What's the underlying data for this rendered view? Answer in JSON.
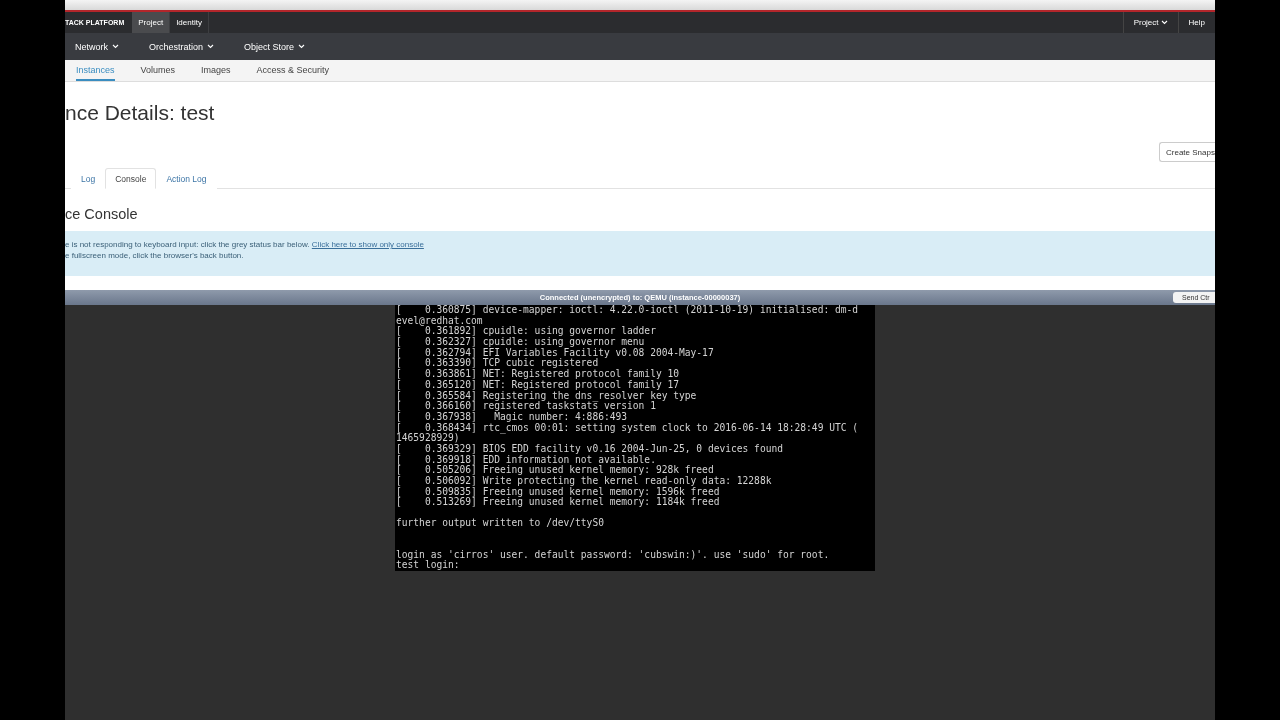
{
  "top_nav": {
    "brand": "TACK PLATFORM",
    "tabs": [
      {
        "label": "Project",
        "selected": true
      },
      {
        "label": "Identity",
        "selected": false
      }
    ],
    "right_menus": [
      {
        "label": "Project",
        "dropdown": true
      },
      {
        "label": "Help",
        "dropdown": false
      }
    ]
  },
  "section_nav": [
    {
      "label": "Network"
    },
    {
      "label": "Orchestration"
    },
    {
      "label": "Object Store"
    }
  ],
  "sub_nav": [
    {
      "label": "Instances",
      "selected": true
    },
    {
      "label": "Volumes",
      "selected": false
    },
    {
      "label": "Images",
      "selected": false
    },
    {
      "label": "Access & Security",
      "selected": false
    }
  ],
  "page_title": "nce Details: test",
  "action_button": "Create Snaps",
  "detail_tabs": [
    {
      "label": "Log",
      "selected": false
    },
    {
      "label": "Console",
      "selected": true
    },
    {
      "label": "Action Log",
      "selected": false
    }
  ],
  "console_heading": "ce Console",
  "info": {
    "line_1": "e is not responding to keyboard input: click the grey status bar below.",
    "link": "Click here to show only console",
    "line_2": "e fullscreen mode, click the browser's back button."
  },
  "status_bar": {
    "text": "Connected (unencrypted) to: QEMU (instance-00000037)",
    "button": "Send Ctr"
  },
  "terminal_lines": [
    {
      "kind": "line",
      "text": "[    0.360875] device-mapper: ioctl: 4.22.0-ioctl (2011-10-19) initialised: dm-d"
    },
    {
      "kind": "line",
      "text": "evel@redhat.com"
    },
    {
      "kind": "line",
      "text": "[    0.361892] cpuidle: using governor ladder"
    },
    {
      "kind": "line",
      "text": "[    0.362327] cpuidle: using governor menu"
    },
    {
      "kind": "line",
      "text": "[    0.362794] EFI Variables Facility v0.08 2004-May-17"
    },
    {
      "kind": "line",
      "text": "[    0.363390] TCP cubic registered"
    },
    {
      "kind": "line",
      "text": "[    0.363861] NET: Registered protocol family 10"
    },
    {
      "kind": "line",
      "text": "[    0.365120] NET: Registered protocol family 17"
    },
    {
      "kind": "line",
      "text": "[    0.365584] Registering the dns_resolver key type"
    },
    {
      "kind": "line",
      "text": "[    0.366160] registered taskstats version 1"
    },
    {
      "kind": "line",
      "text": "[    0.367938]   Magic number: 4:886:493"
    },
    {
      "kind": "line",
      "text": "[    0.368434] rtc_cmos 00:01: setting system clock to 2016-06-14 18:28:49 UTC ("
    },
    {
      "kind": "line",
      "text": "1465928929)"
    },
    {
      "kind": "line",
      "text": "[    0.369329] BIOS EDD facility v0.16 2004-Jun-25, 0 devices found"
    },
    {
      "kind": "line",
      "text": "[    0.369918] EDD information not available."
    },
    {
      "kind": "line",
      "text": "[    0.505206] Freeing unused kernel memory: 928k freed"
    },
    {
      "kind": "line",
      "text": "[    0.506092] Write protecting the kernel read-only data: 12288k"
    },
    {
      "kind": "line",
      "text": "[    0.509835] Freeing unused kernel memory: 1596k freed"
    },
    {
      "kind": "line",
      "text": "[    0.513269] Freeing unused kernel memory: 1184k freed"
    },
    {
      "kind": "blank"
    },
    {
      "kind": "line",
      "text": "further output written to /dev/ttyS0"
    },
    {
      "kind": "blank"
    },
    {
      "kind": "blank"
    },
    {
      "kind": "line",
      "text": "login as 'cirros' user. default password: 'cubswin:)'. use 'sudo' for root."
    },
    {
      "kind": "line",
      "text": "test login:"
    }
  ]
}
